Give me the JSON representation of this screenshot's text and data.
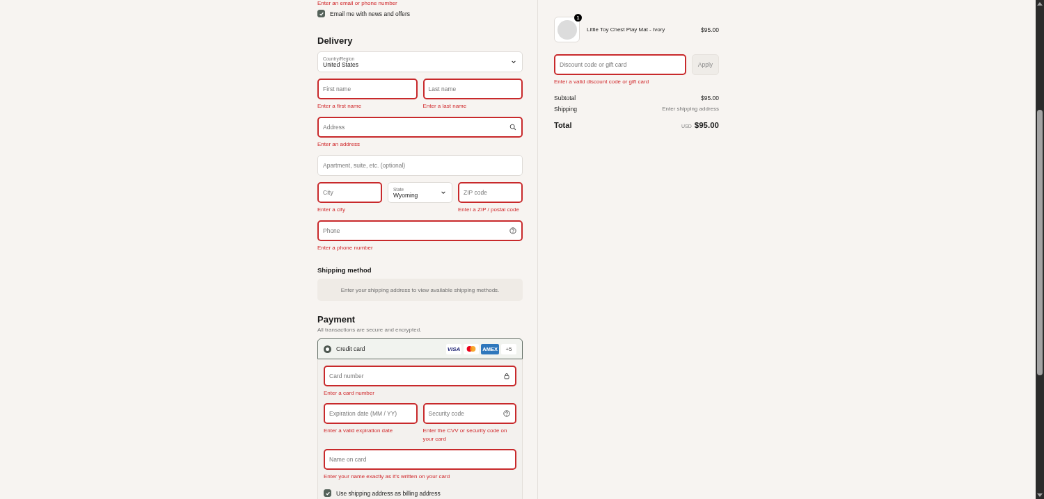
{
  "contact": {
    "error": "Enter an email or phone number",
    "newsletter": {
      "label": "Email me with news and offers",
      "checked": true
    }
  },
  "delivery": {
    "heading": "Delivery",
    "rows": [
      {
        "fields": [
          {
            "kind": "select",
            "label": "Country/Region",
            "value": "United States",
            "invalid": false
          }
        ]
      },
      {
        "fields": [
          {
            "kind": "input",
            "placeholder": "First name",
            "invalid": true,
            "error": "Enter a first name"
          },
          {
            "kind": "input",
            "placeholder": "Last name",
            "invalid": true,
            "error": "Enter a last name"
          }
        ]
      },
      {
        "fields": [
          {
            "kind": "search_input",
            "placeholder": "Address",
            "invalid": true,
            "error": "Enter an address"
          }
        ]
      },
      {
        "fields": [
          {
            "kind": "input",
            "placeholder": "Apartment, suite, etc. (optional)",
            "invalid": false
          }
        ]
      },
      {
        "fields": [
          {
            "kind": "input",
            "placeholder": "City",
            "invalid": true,
            "error": "Enter a city"
          },
          {
            "kind": "select",
            "label": "State",
            "value": "Wyoming",
            "invalid": false
          },
          {
            "kind": "input",
            "placeholder": "ZIP code",
            "invalid": true,
            "error": "Enter a ZIP / postal code"
          }
        ]
      },
      {
        "fields": [
          {
            "kind": "help_input",
            "placeholder": "Phone",
            "invalid": true,
            "error": "Enter a phone number"
          }
        ]
      }
    ]
  },
  "shipping_method": {
    "heading": "Shipping method",
    "message": "Enter your shipping address to view available shipping methods."
  },
  "payment": {
    "heading": "Payment",
    "note": "All transactions are secure and encrypted.",
    "method": {
      "label": "Credit card",
      "selected": true,
      "brands": [
        {
          "kind": "visa",
          "text": "VISA"
        },
        {
          "kind": "mastercard"
        },
        {
          "kind": "amex",
          "text": "AMEX"
        },
        {
          "kind": "more",
          "text": "+5"
        }
      ]
    },
    "rows": [
      {
        "fields": [
          {
            "kind": "lock_input",
            "placeholder": "Card number",
            "invalid": true,
            "error": "Enter a card number"
          }
        ]
      },
      {
        "fields": [
          {
            "kind": "input",
            "placeholder": "Expiration date (MM / YY)",
            "invalid": true,
            "error": "Enter a valid expiration date"
          },
          {
            "kind": "help_input",
            "placeholder": "Security code",
            "invalid": true,
            "error": "Enter the CVV or security code on your card"
          }
        ]
      },
      {
        "fields": [
          {
            "kind": "input",
            "placeholder": "Name on card",
            "invalid": true,
            "error": "Enter your name exactly as it's written on your card"
          }
        ]
      }
    ],
    "billing": {
      "label": "Use shipping address as billing address",
      "checked": true
    }
  },
  "summary": {
    "item": {
      "quantity": "1",
      "name": "Little Toy Chest Play Mat - Ivory",
      "price": "$95.00"
    },
    "discount": {
      "placeholder": "Discount code or gift card",
      "invalid": true,
      "error": "Enter a valid discount code or gift card",
      "button": "Apply"
    },
    "lines": [
      {
        "label": "Subtotal",
        "value": "$95.00",
        "muted": false
      },
      {
        "label": "Shipping",
        "value": "Enter shipping address",
        "muted": true
      }
    ],
    "total": {
      "label": "Total",
      "currency": "USD",
      "amount": "$95.00"
    }
  }
}
